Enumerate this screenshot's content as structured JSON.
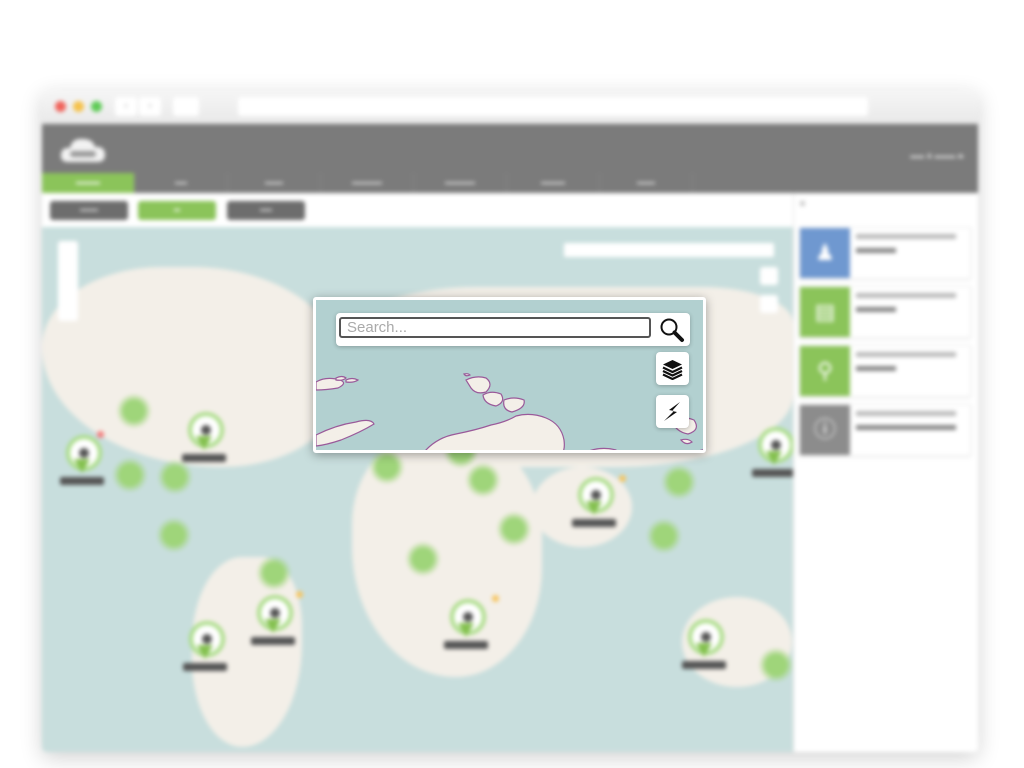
{
  "browser": {
    "traffic_lights": {
      "close": "#f0635b",
      "minimize": "#f5c24c",
      "zoom": "#5fcb57"
    },
    "back_icon": "‹",
    "forward_icon": "›"
  },
  "app": {
    "accent_color": "#8bc45a",
    "header_color": "#7b7b7b",
    "nav_tabs_count": 7,
    "active_tab_index": 0,
    "sub_buttons": [
      {
        "state": "default"
      },
      {
        "state": "active"
      },
      {
        "state": "default"
      }
    ]
  },
  "sidebar": {
    "cards": [
      {
        "icon": "user-icon",
        "glyph": "♟",
        "color": "#6f98d0"
      },
      {
        "icon": "gateway-icon",
        "glyph": "▤",
        "color": "#8bc45a"
      },
      {
        "icon": "hotspot-icon",
        "glyph": "⚲",
        "color": "#8bc45a"
      },
      {
        "icon": "info-icon",
        "glyph": "ⓘ",
        "color": "#8c8c8c"
      }
    ]
  },
  "map_popup": {
    "search": {
      "placeholder": "Search...",
      "value": ""
    },
    "buttons": [
      {
        "name": "layers",
        "icon": "layers-icon"
      },
      {
        "name": "lightning",
        "icon": "lightning-icon"
      }
    ],
    "water_color": "#b2d0d0",
    "land_color": "#f3efe8",
    "coast_color": "#9a5a9a"
  }
}
